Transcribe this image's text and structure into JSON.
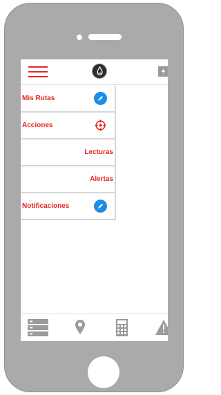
{
  "menu": {
    "items": [
      {
        "label": "Mis Rutas",
        "icon": "pencil-icon"
      },
      {
        "label": "Acciones",
        "icon": "target-icon"
      },
      {
        "label": "Lecturas"
      },
      {
        "label": "Alertas"
      },
      {
        "label": "Notificaciones",
        "icon": "pencil-icon"
      }
    ]
  },
  "colors": {
    "accent": "#e8251f",
    "icon_blue": "#1e8be6",
    "frame": "#aaaaaa",
    "icon_gray": "#9b9b9b"
  },
  "bottom_bar": {
    "icons": [
      "list-icon",
      "map-pin-icon",
      "calculator-icon",
      "warning-icon"
    ]
  }
}
